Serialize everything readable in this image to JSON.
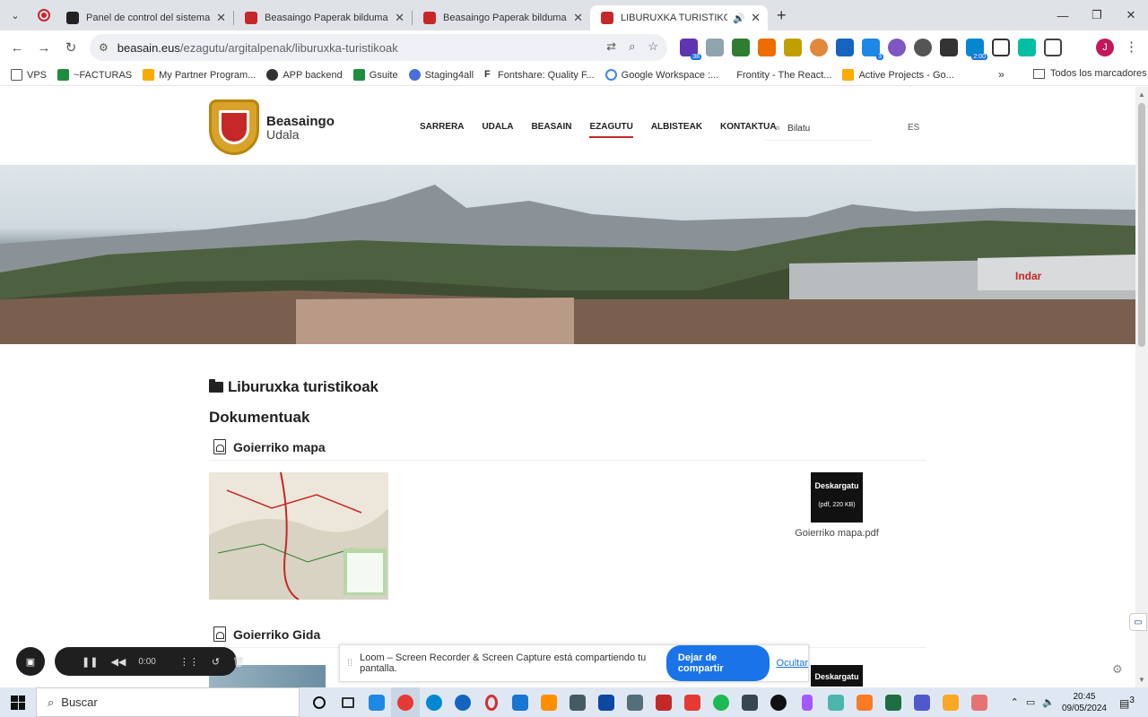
{
  "browser": {
    "tabs": [
      {
        "title": "Panel de control del sistema - B",
        "fav_color": "#222222",
        "active": false
      },
      {
        "title": "Beasaingo Paperak bilduma - B",
        "fav_color": "#c62828",
        "active": false
      },
      {
        "title": "Beasaingo Paperak bilduma - B",
        "fav_color": "#c62828",
        "active": false
      },
      {
        "title": "LIBURUXKA TURISTIKOAK",
        "fav_color": "#c62828",
        "active": true
      }
    ],
    "window_controls": {
      "minimize": "—",
      "restore": "❐",
      "close": "✕"
    },
    "new_tab": "+",
    "url_host": "beasain.eus",
    "url_path": "/ezagutu/argitalpenak/liburuxka-turistikoak",
    "extension_badges": {
      "ext1": "38",
      "ext2": "3",
      "ext3": "2:00"
    },
    "profile_initial": "J",
    "bookmarks": [
      {
        "label": "VPS",
        "color": "#555555"
      },
      {
        "label": "~FACTURAS",
        "color": "#1e8e3e"
      },
      {
        "label": "My Partner Program...",
        "color": "#f9ab00"
      },
      {
        "label": "APP backend",
        "color": "#333333"
      },
      {
        "label": "Gsuite",
        "color": "#1e8e3e"
      },
      {
        "label": "Staging4all",
        "color": "#4a6fd8"
      },
      {
        "label": "Fontshare: Quality F...",
        "color": "#111111"
      },
      {
        "label": "Google Workspace :...",
        "color": "#4285f4"
      },
      {
        "label": "Frontity - The React...",
        "color": "#ffffff"
      },
      {
        "label": "Active Projects - Go...",
        "color": "#f9ab00"
      }
    ],
    "bookmarks_more": "»",
    "all_bookmarks": "Todos los marcadores"
  },
  "site": {
    "logo_line1": "Beasaingo",
    "logo_line2": "Udala",
    "nav": [
      "SARRERA",
      "UDALA",
      "BEASAIN",
      "EZAGUTU",
      "ALBISTEAK",
      "KONTAKTUA"
    ],
    "nav_current_index": 3,
    "search_placeholder": "Bilatu",
    "lang": "ES",
    "hero_sign": "Indar"
  },
  "content": {
    "heading": "Liburuxka turistikoak",
    "subheading": "Dokumentuak",
    "documents": [
      {
        "title": "Goierriko mapa",
        "download_label": "Deskargatu",
        "file_meta": "(pdf, 220 KB)",
        "file_name": "Goierriko mapa.pdf"
      },
      {
        "title": "Goierriko Gida",
        "download_label": "Deskargatu"
      }
    ]
  },
  "loom": {
    "timer": "0:00",
    "share_text": "Loom – Screen Recorder & Screen Capture está compartiendo tu pantalla.",
    "stop_share": "Dejar de compartir",
    "hide": "Ocultar"
  },
  "taskbar": {
    "search": "Buscar",
    "time": "20:45",
    "date": "09/05/2024",
    "notifications": "3"
  }
}
